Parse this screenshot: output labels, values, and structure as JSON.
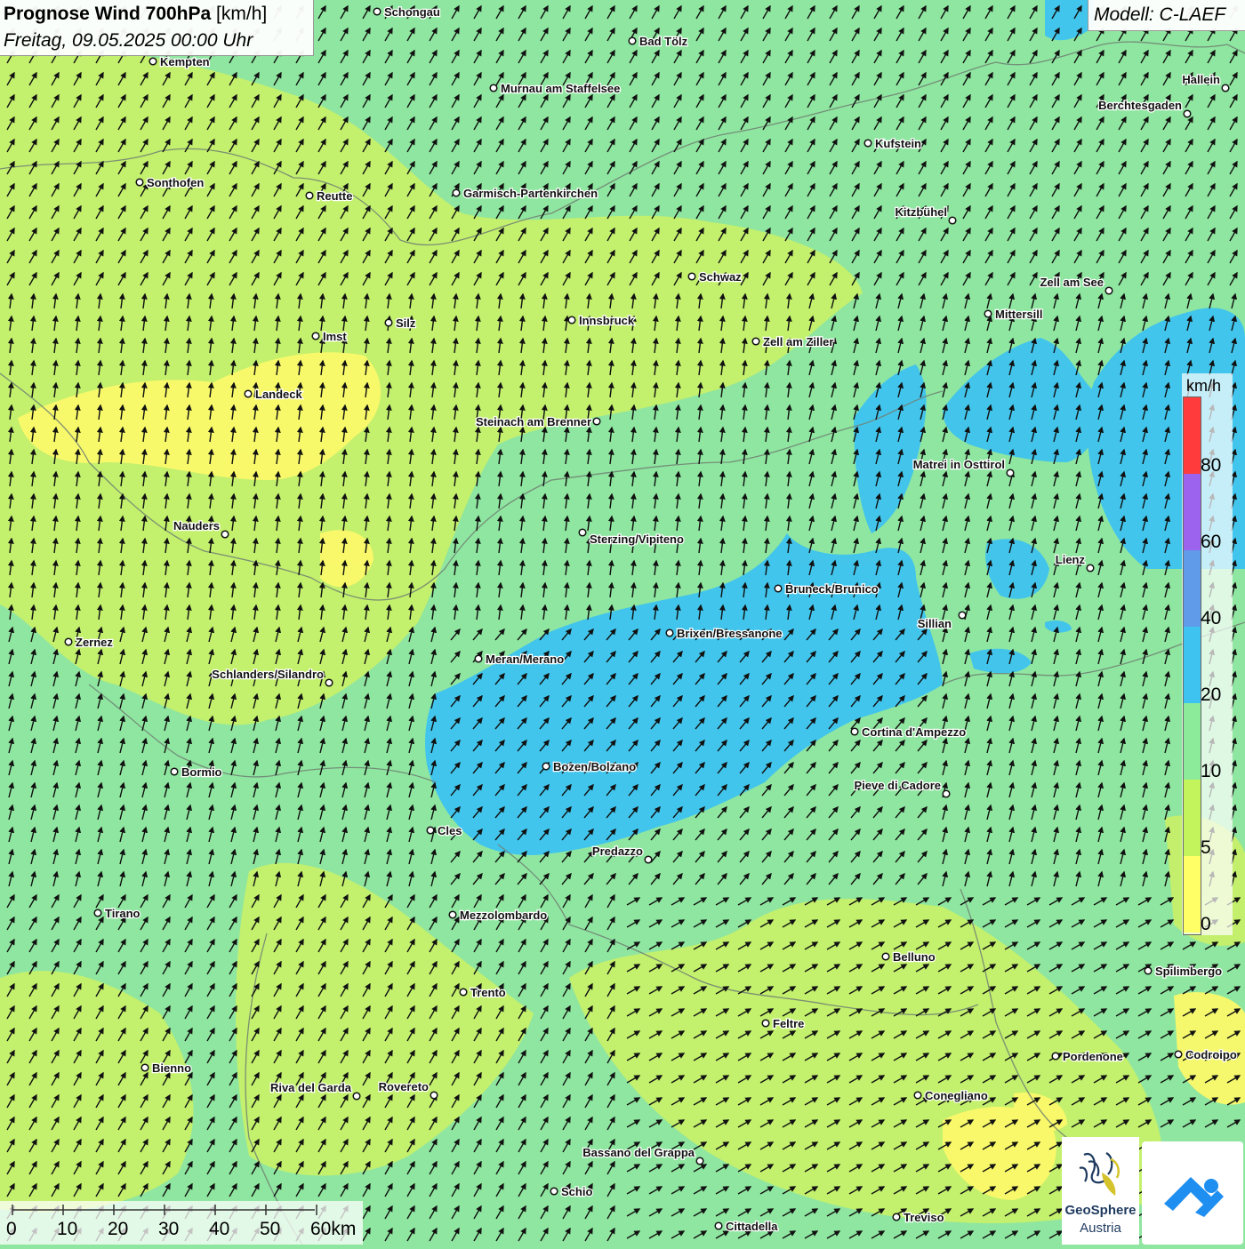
{
  "title": {
    "main": "Prognose Wind 700hPa",
    "unit": "[km/h]",
    "date": "Freitag, 09.05.2025 00:00 Uhr"
  },
  "model": "Modell: C-LAEF",
  "legend": {
    "unit": "km/h",
    "labels": [
      "80",
      "60",
      "40",
      "20",
      "10",
      "5",
      "0"
    ],
    "colors": [
      "#ff3b3b",
      "#9b63ee",
      "#5f9be8",
      "#3ec3f0",
      "#8ceb9b",
      "#c4f45c",
      "#ffff66"
    ]
  },
  "scalebar": {
    "labels": [
      "0",
      "10",
      "20",
      "30",
      "40",
      "50",
      "60km"
    ]
  },
  "logos": {
    "geosphere_line1": "GeoSphere",
    "geosphere_line2": "Austria",
    "icon_names": [
      "geosphere-logo-icon",
      "weather-app-logo-icon"
    ]
  },
  "cities": [
    "Schongau",
    "Bad Tölz",
    "Kempten",
    "Murnau am Staffelsee",
    "Hallein",
    "Berchtesgaden",
    "Kufstein",
    "Sonthofen",
    "Reutte",
    "Garmisch-Partenkirchen",
    "Kitzbühel",
    "Schwaz",
    "Zell am See",
    "Mittersill",
    "Innsbruck",
    "Silz",
    "Imst",
    "Zell am Ziller",
    "Landeck",
    "Steinach am Brenner",
    "Matrei in Osttirol",
    "Nauders",
    "Sterzing/Vipiteno",
    "Lienz",
    "Bruneck/Brunico",
    "Sillian",
    "Brixen/Bressanone",
    "Zernez",
    "Meran/Merano",
    "Schlanders/Silandro",
    "Cortina d'Ampezzo",
    "Bormio",
    "Bozen/Bolzano",
    "Pieve di Cadore",
    "Cles",
    "Predazzo",
    "Tirano",
    "Mezzolombardo",
    "Belluno",
    "Spilimbergo",
    "Trento",
    "Feltre",
    "Bienno",
    "Pordenone",
    "Codroipo",
    "Riva del Garda",
    "Rovereto",
    "Conegliano",
    "Bassano del Grappa",
    "Schio",
    "Treviso",
    "Cittadella"
  ],
  "wind_colors": {
    "calm_0_5": "#ffff66",
    "light_5_10": "#c4f45c",
    "moderate_10_20": "#8ceb9b",
    "fresh_20_40": "#3ec3f0"
  }
}
